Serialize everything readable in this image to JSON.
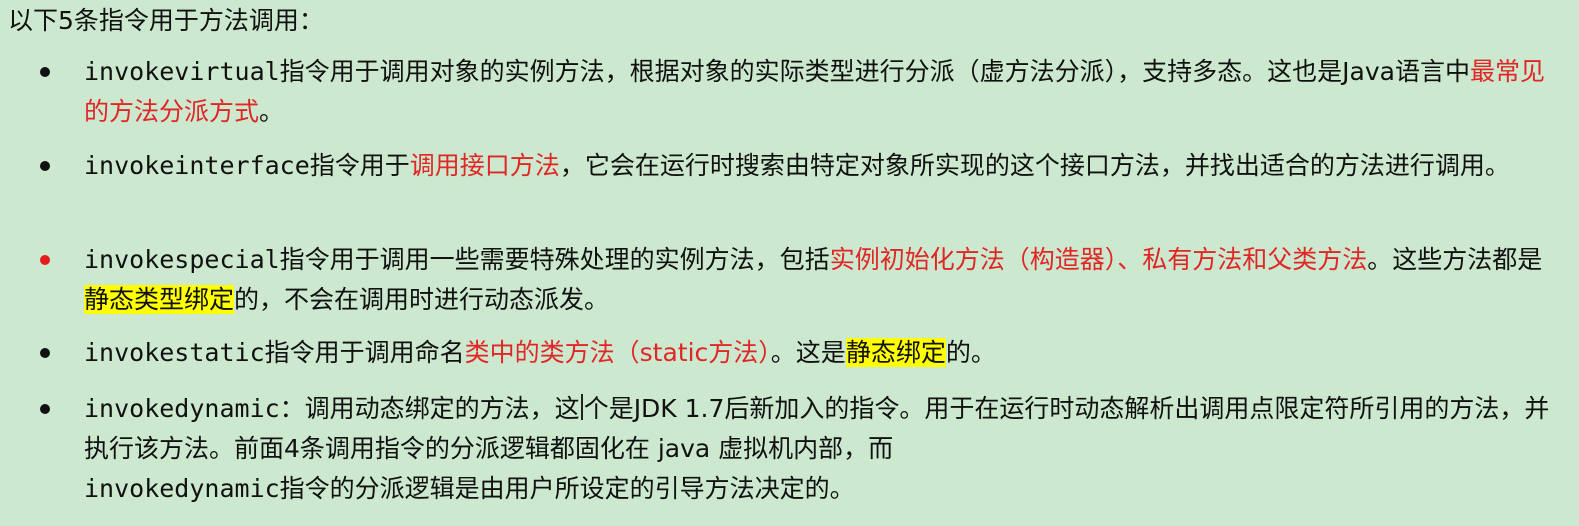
{
  "intro": "以下5条指令用于方法调用：",
  "items": [
    {
      "name": "invokevirtual",
      "t1": "指令用于调用对象的实例方法，根据对象的实际类型进行分派（虚方法分派），支持多态。这也是Java语言中",
      "t2": "最常见的方法分派方式",
      "t3": "。"
    },
    {
      "name": "invokeinterface",
      "t1": "指令用于",
      "t2": "调用接口方法",
      "t3": "，它会在运行时搜索由特定对象所实现的这个接口方法，并找出适合的方法进行调用。"
    },
    {
      "name": "invokespecial",
      "t1": "指令用于调用一些需要特殊处理的实例方法，包括",
      "t2": "实例初始化方法（构造器）、私有方法和父类方法",
      "t3": "。这些方法都是",
      "t4": "静态类型绑定",
      "t5": "的，不会在调用时进行动态派发。"
    },
    {
      "name": "invokestatic",
      "t1": "指令用于调用命名",
      "t2": "类中的类方法（static方法）",
      "t3": "。这是",
      "t4": "静态绑定",
      "t5": "的。"
    },
    {
      "name": "invokedynamic",
      "t1": "：调用动态绑定的方法，这",
      "t2": "个是JDK 1.7后新加入的指令。用于在运行时动态解析出调用点限定符所引用的方法，并执行该方法。前面4条调用指令的分派逻辑都固化在 java 虚拟机内部，而",
      "t3": "invokedynamic",
      "t4": "指令的分派逻辑是由用户所设定的引导方法决定的。"
    }
  ]
}
